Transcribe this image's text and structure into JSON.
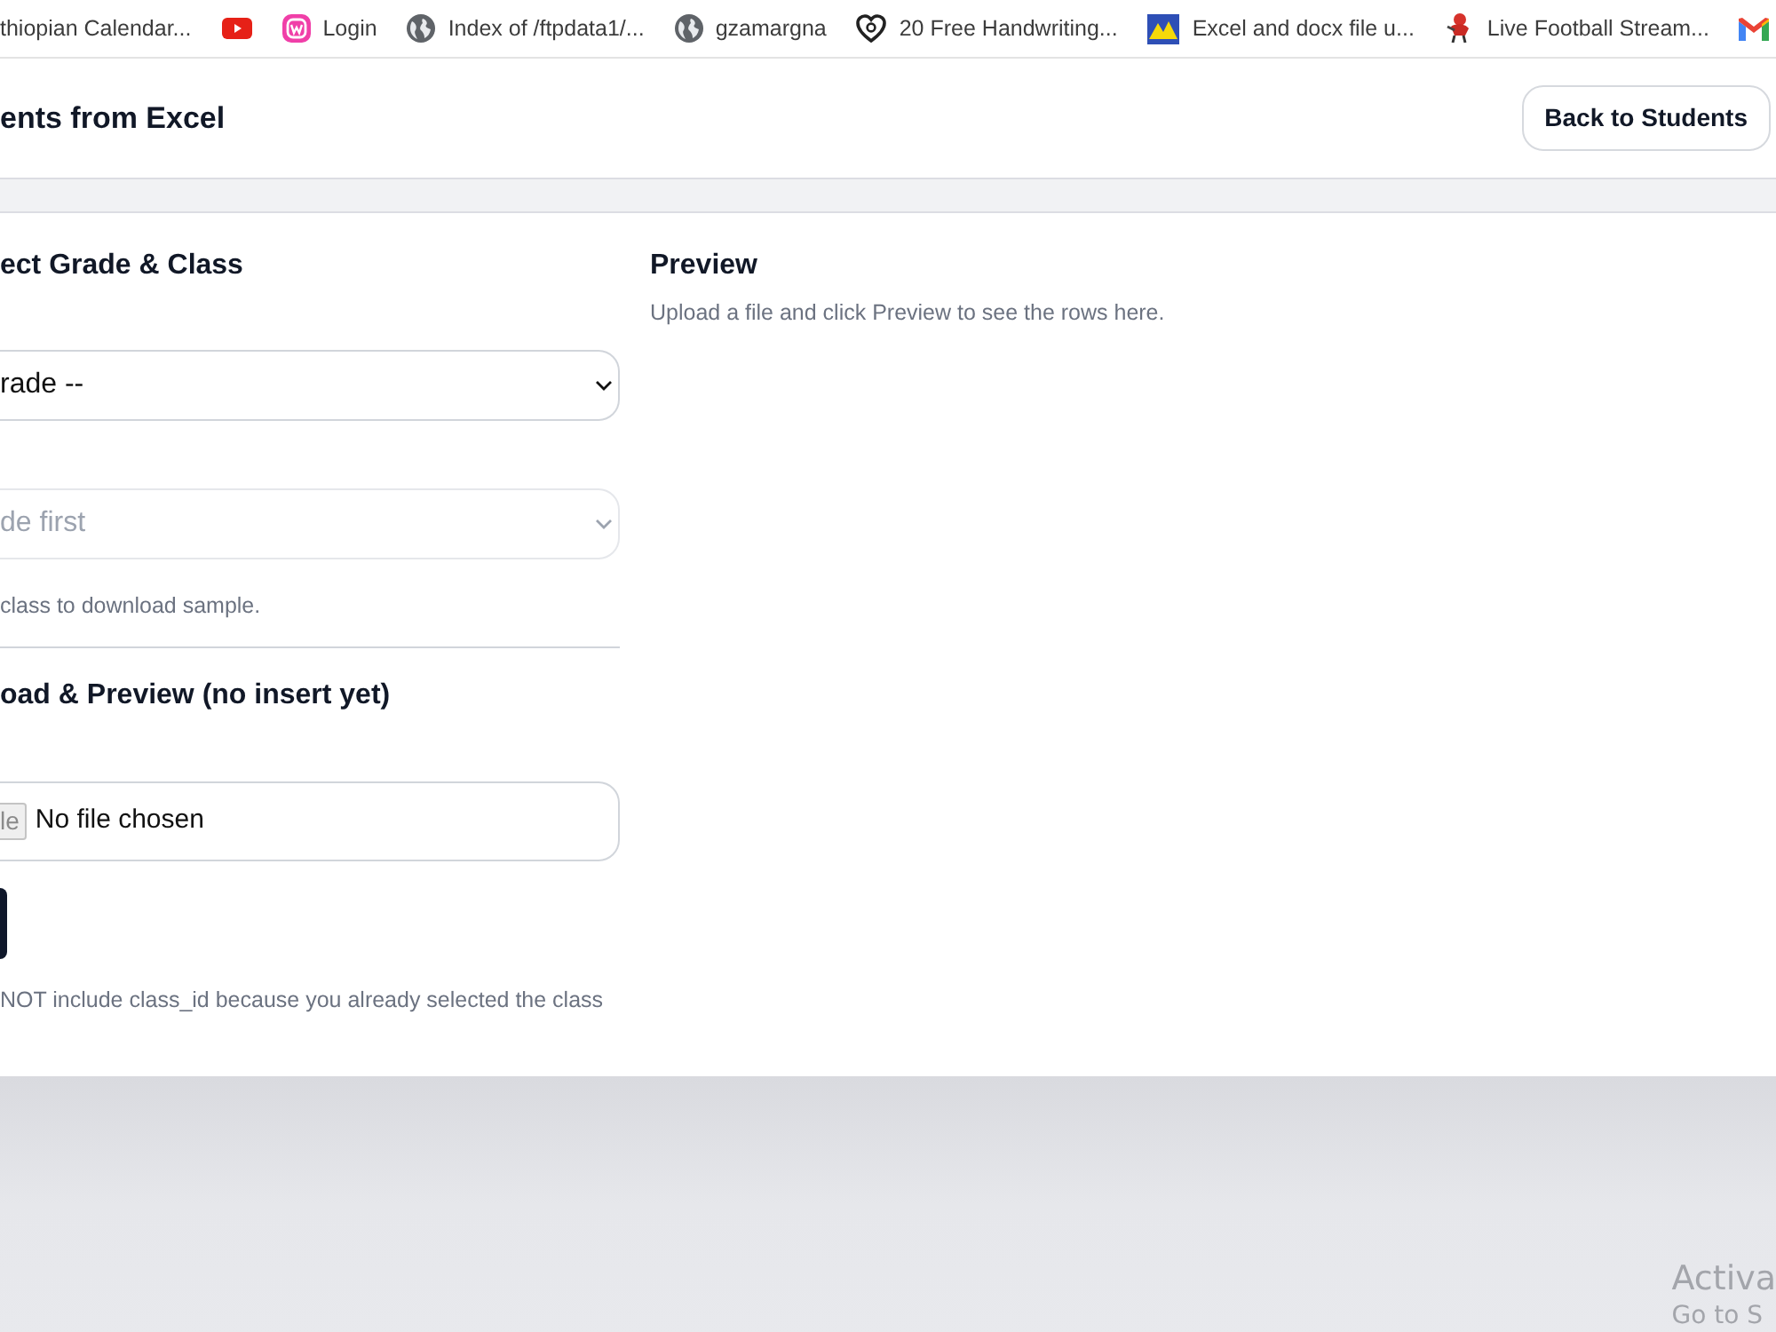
{
  "bookmarks": [
    {
      "kind": "text",
      "label": "thiopian Calendar..."
    },
    {
      "kind": "icon"
    },
    {
      "kind": "link",
      "label": "Login"
    },
    {
      "kind": "link",
      "label": "Index of /ftpdata1/..."
    },
    {
      "kind": "link",
      "label": "gzamargna"
    },
    {
      "kind": "link",
      "label": "20 Free Handwriting..."
    },
    {
      "kind": "link",
      "label": "Excel and docx file u..."
    },
    {
      "kind": "link",
      "label": "Live Football Stream..."
    },
    {
      "kind": "icon"
    }
  ],
  "header": {
    "title": "ents from Excel",
    "back_button": "Back to Students"
  },
  "select_section": {
    "heading": "ect Grade & Class",
    "grade_select": {
      "value": "rade --",
      "disabled": false
    },
    "class_select": {
      "value": "de first",
      "disabled": true
    },
    "hint": "class to download sample."
  },
  "upload_section": {
    "heading": "oad & Preview (no insert yet)",
    "file_input": {
      "button": "le",
      "status": "No file chosen"
    },
    "note": "NOT include class_id because you already selected the class"
  },
  "preview": {
    "heading": "Preview",
    "message": "Upload a file and click Preview to see the rows here."
  },
  "activation_notice": {
    "line_1": "Activa",
    "line_2": "Go to S"
  }
}
